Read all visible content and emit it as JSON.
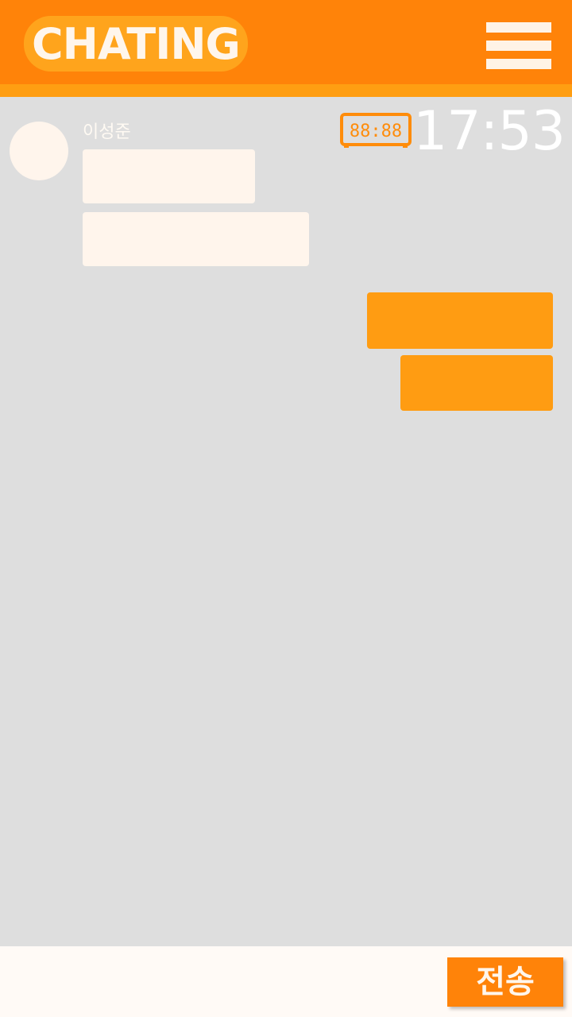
{
  "header": {
    "title": "CHATING",
    "menu_icon": "hamburger-menu-icon",
    "colors": {
      "primary": "#ff8309",
      "strip": "#ff9e12",
      "title_badge": "#ffa41c"
    }
  },
  "clock": {
    "icon": "digital-clock-icon",
    "icon_digits": "88:88",
    "time": "17:53"
  },
  "conversation": {
    "background": "#dedede",
    "incoming": {
      "sender_name": "이성준",
      "avatar_icon": "avatar-placeholder",
      "messages": [
        "",
        ""
      ],
      "bubble_color": "#fff5ec"
    },
    "outgoing": {
      "messages": [
        "",
        ""
      ],
      "bubble_color": "#ff9c12"
    }
  },
  "composer": {
    "input_value": "",
    "placeholder": "",
    "send_label": "전송"
  }
}
